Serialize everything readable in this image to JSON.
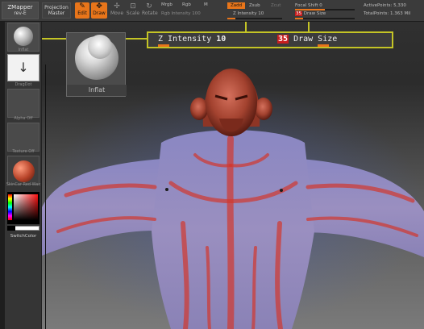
{
  "top_bar": {
    "zmapper": "ZMapper",
    "zmapper_sub": "rev-E",
    "projection": "Projection",
    "projection_sub": "Master",
    "edit_label": "Edit",
    "draw_label": "Draw",
    "move_label": "Move",
    "scale_label": "Scale",
    "rotate_label": "Rotate",
    "mrgb": "Mrgb",
    "rgb": "Rgb",
    "m": "M",
    "rgb_intensity": "Rgb Intensity 100",
    "zadd": "Zadd",
    "zsub": "Zsub",
    "zcut": "Zcut",
    "z_intensity": "Z Intensity 10",
    "draw_size_value": "35",
    "draw_size_label": "Draw Size",
    "focal_shift": "Focal Shift 0",
    "active_points": "ActivePoints: 5,330",
    "total_points": "TotalPoints: 1.363 Mil"
  },
  "left_panel": {
    "inflat": "Inflat",
    "dragdot": "DragDot",
    "alpha_off": "Alpha Off",
    "texture_off": "Texture Off",
    "material": "SkinCar Red Wax",
    "switch_color": "SwitchColor"
  },
  "brush_popup": {
    "label": "Inflat"
  },
  "settings_bar": {
    "z_intensity_label": "Z Intensity",
    "z_intensity_value": "10",
    "draw_size_value": "35",
    "draw_size_label": "Draw Size"
  },
  "colors": {
    "accent": "#e8751a",
    "highlight": "#c4c426",
    "badge": "#c81e1e",
    "model_red": "#a8443a",
    "model_blue": "#6a78b8"
  }
}
